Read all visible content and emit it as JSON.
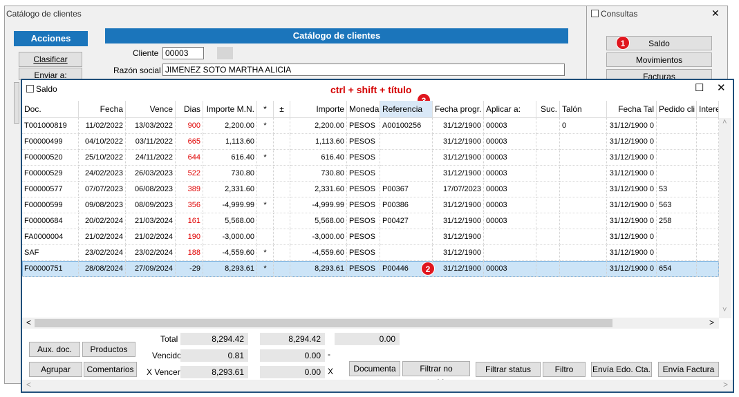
{
  "back_window": {
    "title": "Catálogo de clientes",
    "acciones_header": "Acciones",
    "catalog_header": "Catálogo de clientes",
    "buttons": [
      "Clasificar",
      "Enviar a:"
    ],
    "cliente_label": "Cliente",
    "cliente_value": "00003",
    "razon_label": "Razón social",
    "razon_value": "JIMENEZ SOTO MARTHA ALICIA"
  },
  "consultas": {
    "title": "Consultas",
    "close": "✕",
    "buttons": [
      "Saldo",
      "Movimientos",
      "Facturas"
    ],
    "badge1": "1"
  },
  "saldo": {
    "title": "Saldo",
    "annotation": "ctrl + shift + título",
    "badge2": "2",
    "badge3": "3",
    "maximize": "☐",
    "close": "✕",
    "columns": [
      "Doc.",
      "Fecha",
      "Vence",
      "Dias",
      "Importe M.N.",
      "*",
      "±",
      "Importe",
      "Moneda",
      "Referencia",
      "Fecha progr.",
      "Aplicar a:",
      "Suc.",
      "Talón",
      "Fecha Tal",
      "Pedido cli",
      "Intereses"
    ],
    "rows": [
      [
        "T001000819",
        "11/02/2022",
        "13/03/2022",
        "900",
        "2,200.00",
        "*",
        "",
        "2,200.00",
        "PESOS",
        "A00100256",
        "31/12/1900",
        "00003",
        "",
        "0",
        "31/12/1900 0",
        "",
        ""
      ],
      [
        "F00000499",
        "04/10/2022",
        "03/11/2022",
        "665",
        "1,113.60",
        "",
        "",
        "1,113.60",
        "PESOS",
        "",
        "31/12/1900",
        "00003",
        "",
        "",
        "31/12/1900 0",
        "",
        ""
      ],
      [
        "F00000520",
        "25/10/2022",
        "24/11/2022",
        "644",
        "616.40",
        "*",
        "",
        "616.40",
        "PESOS",
        "",
        "31/12/1900",
        "00003",
        "",
        "",
        "31/12/1900 0",
        "",
        ""
      ],
      [
        "F00000529",
        "24/02/2023",
        "26/03/2023",
        "522",
        "730.80",
        "",
        "",
        "730.80",
        "PESOS",
        "",
        "31/12/1900",
        "00003",
        "",
        "",
        "31/12/1900 0",
        "",
        ""
      ],
      [
        "F00000577",
        "07/07/2023",
        "06/08/2023",
        "389",
        "2,331.60",
        "",
        "",
        "2,331.60",
        "PESOS",
        "P00367",
        "17/07/2023",
        "00003",
        "",
        "",
        "31/12/1900 0",
        "53",
        ""
      ],
      [
        "F00000599",
        "09/08/2023",
        "08/09/2023",
        "356",
        "-4,999.99",
        "*",
        "",
        "-4,999.99",
        "PESOS",
        "P00386",
        "31/12/1900",
        "00003",
        "",
        "",
        "31/12/1900 0",
        "563",
        ""
      ],
      [
        "F00000684",
        "20/02/2024",
        "21/03/2024",
        "161",
        "5,568.00",
        "",
        "",
        "5,568.00",
        "PESOS",
        "P00427",
        "31/12/1900",
        "00003",
        "",
        "",
        "31/12/1900 0",
        "258",
        ""
      ],
      [
        "FA0000004",
        "21/02/2024",
        "21/02/2024",
        "190",
        "-3,000.00",
        "",
        "",
        "-3,000.00",
        "PESOS",
        "",
        "31/12/1900",
        "",
        "",
        "",
        "31/12/1900 0",
        "",
        ""
      ],
      [
        "SAF",
        "23/02/2024",
        "23/02/2024",
        "188",
        "-4,559.60",
        "*",
        "",
        "-4,559.60",
        "PESOS",
        "",
        "31/12/1900",
        "",
        "",
        "",
        "31/12/1900 0",
        "",
        ""
      ],
      [
        "F00000751",
        "28/08/2024",
        "27/09/2024",
        "-29",
        "8,293.61",
        "*",
        "",
        "8,293.61",
        "PESOS",
        "P00446",
        "31/12/1900",
        "00003",
        "",
        "",
        "31/12/1900 0",
        "654",
        ""
      ]
    ],
    "selected_row": 9,
    "scroll_left": "<",
    "scroll_right": ">",
    "scroll_up": "˄",
    "scroll_down": "˅",
    "scroll_h2_left": "<",
    "scroll_h2_right": ">",
    "totals": {
      "total_label": "Total",
      "total_mn": "8,294.42",
      "total_imp": "8,294.42",
      "total_other": "0.00",
      "vencido_label": "Vencido",
      "vencido_mn": "0.81",
      "vencido_imp": "0.00",
      "vencido_suffix": "-",
      "xvencer_label": "X Vencer",
      "xvencer_mn": "8,293.61",
      "xvencer_imp": "0.00",
      "xvencer_suffix": "X"
    },
    "buttons": {
      "aux_doc": "Aux. doc.",
      "productos": "Productos",
      "agrupar": "Agrupar",
      "comentarios": "Comentarios",
      "documenta": "Documenta",
      "filtrar_no_vencidos": "Filtrar no vencidos",
      "filtrar_status": "Filtrar status",
      "filtro": "Filtro",
      "envia_edo": "Envía Edo. Cta.",
      "envia_factura": "Envía Factura"
    }
  }
}
